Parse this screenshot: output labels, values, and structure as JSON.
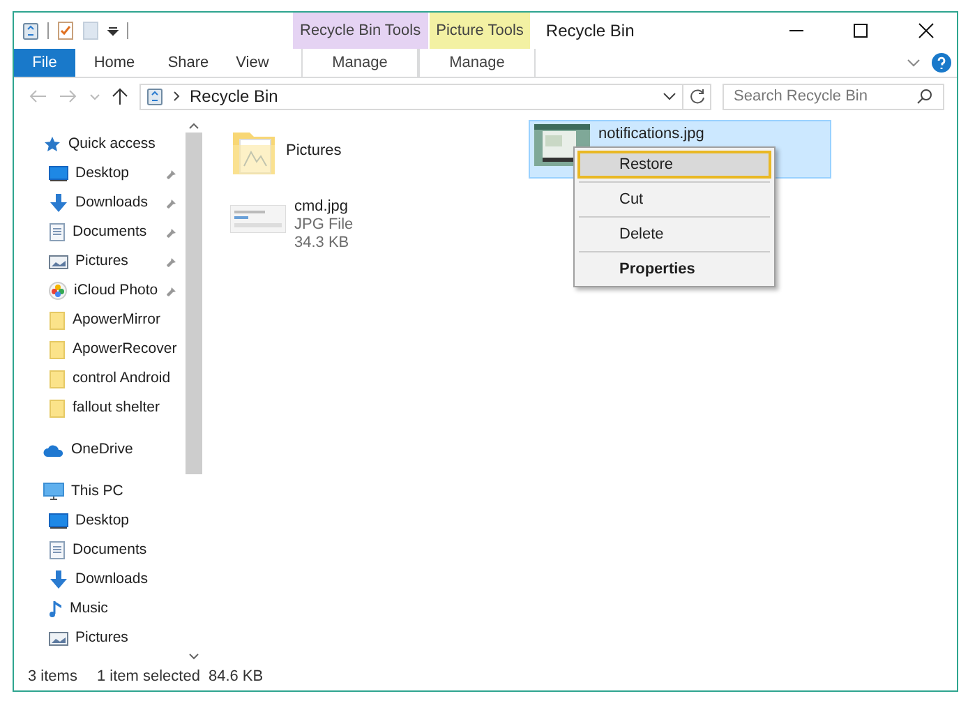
{
  "window": {
    "title": "Recycle Bin"
  },
  "context_tabs": [
    {
      "label": "Recycle Bin Tools",
      "color": "#e5d3f3",
      "tab": "Manage"
    },
    {
      "label": "Picture Tools",
      "color": "#f3f1a3",
      "tab": "Manage"
    }
  ],
  "ribbon_tabs": [
    {
      "label": "File",
      "kind": "file"
    },
    {
      "label": "Home",
      "kind": "tab"
    },
    {
      "label": "Share",
      "kind": "tab"
    },
    {
      "label": "View",
      "kind": "tab"
    }
  ],
  "address": {
    "path": "Recycle Bin"
  },
  "search": {
    "placeholder": "Search Recycle Bin"
  },
  "sidebar": {
    "items": [
      {
        "label": "Quick access",
        "kind": "star",
        "children": [
          {
            "label": "Desktop",
            "kind": "desktop",
            "pinned": true
          },
          {
            "label": "Downloads",
            "kind": "downloads",
            "pinned": true
          },
          {
            "label": "Documents",
            "kind": "documents",
            "pinned": true
          },
          {
            "label": "Pictures",
            "kind": "pictures",
            "pinned": true
          },
          {
            "label": "iCloud Photo",
            "kind": "photos",
            "pinned": true
          },
          {
            "label": "ApowerMirror",
            "kind": "folder",
            "pinned": false
          },
          {
            "label": "ApowerRecover",
            "kind": "folder",
            "pinned": false
          },
          {
            "label": "control Android",
            "kind": "folder",
            "pinned": false
          },
          {
            "label": "fallout shelter",
            "kind": "folder",
            "pinned": false
          }
        ]
      },
      {
        "label": "OneDrive",
        "kind": "cloud"
      },
      {
        "label": "This PC",
        "kind": "pc",
        "children": [
          {
            "label": "Desktop",
            "kind": "desktop",
            "pinned": false
          },
          {
            "label": "Documents",
            "kind": "documents",
            "pinned": false
          },
          {
            "label": "Downloads",
            "kind": "downloads",
            "pinned": false
          },
          {
            "label": "Music",
            "kind": "music",
            "pinned": false
          },
          {
            "label": "Pictures",
            "kind": "pictures",
            "pinned": false
          }
        ]
      }
    ]
  },
  "files": [
    {
      "name": "Pictures",
      "kind": "folder",
      "selected": false
    },
    {
      "name": "cmd.jpg",
      "kind": "picture",
      "details": [
        "JPG File",
        "34.3 KB"
      ],
      "selected": false
    },
    {
      "name": "notifications.jpg",
      "kind": "picture",
      "selected": true
    }
  ],
  "context_menu": {
    "items": [
      {
        "label": "Restore",
        "selected": true,
        "default": false
      },
      {
        "label": "Cut",
        "selected": false,
        "default": false
      },
      {
        "label": "Delete",
        "selected": false,
        "default": false
      },
      {
        "label": "Properties",
        "selected": false,
        "default": true
      }
    ]
  },
  "status_bar": [
    "3 items",
    "1 item selected",
    "84.6 KB"
  ]
}
